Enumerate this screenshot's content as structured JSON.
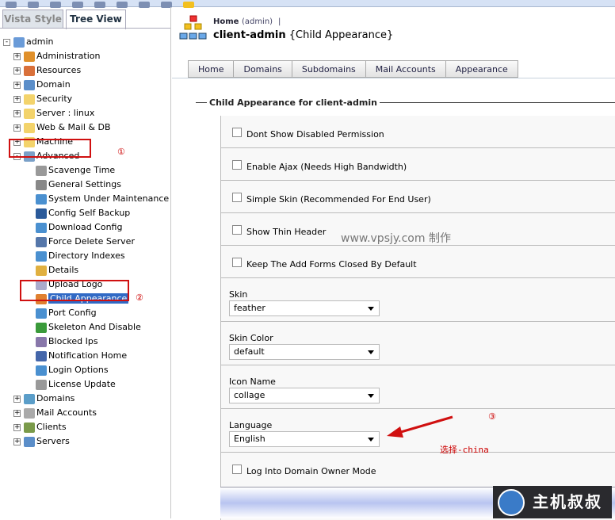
{
  "left_tabs": [
    "Vista Style",
    "Tree View"
  ],
  "tree": [
    {
      "label": "admin",
      "level": 0,
      "pm": "-",
      "color": "#6a9bd8"
    },
    {
      "label": "Administration",
      "level": 1,
      "pm": "+",
      "color": "#e0902a"
    },
    {
      "label": "Resources",
      "level": 1,
      "pm": "+",
      "color": "#d9703a"
    },
    {
      "label": "Domain",
      "level": 1,
      "pm": "+",
      "color": "#5b8ec9"
    },
    {
      "label": "Security",
      "level": 1,
      "pm": "+",
      "color": "#f3d36b"
    },
    {
      "label": "Server  : linux",
      "level": 1,
      "pm": "+",
      "color": "#f3d36b"
    },
    {
      "label": "Web & Mail & DB",
      "level": 1,
      "pm": "+",
      "color": "#f3d36b"
    },
    {
      "label": "Machine",
      "level": 1,
      "pm": "+",
      "color": "#f3d36b"
    },
    {
      "label": "Advanced",
      "level": 1,
      "pm": "-",
      "color": "#7aa0c8"
    },
    {
      "label": "Scavenge Time",
      "level": 2,
      "color": "#999"
    },
    {
      "label": "General Settings",
      "level": 2,
      "color": "#888"
    },
    {
      "label": "System Under Maintenance",
      "level": 2,
      "color": "#4a90d0"
    },
    {
      "label": "Config Self Backup",
      "level": 2,
      "color": "#2a5a9a"
    },
    {
      "label": "Download Config",
      "level": 2,
      "color": "#4a90d0"
    },
    {
      "label": "Force Delete Server",
      "level": 2,
      "color": "#5577aa"
    },
    {
      "label": "Directory Indexes",
      "level": 2,
      "color": "#4a90d0"
    },
    {
      "label": "Details",
      "level": 2,
      "color": "#e0b040"
    },
    {
      "label": "Upload Logo",
      "level": 2,
      "color": "#aac"
    },
    {
      "label": "Child Appearance",
      "level": 2,
      "color": "#e08030",
      "selected": true
    },
    {
      "label": "Port Config",
      "level": 2,
      "color": "#4a90d0"
    },
    {
      "label": "Skeleton And Disable",
      "level": 2,
      "color": "#3a9a3a"
    },
    {
      "label": "Blocked Ips",
      "level": 2,
      "color": "#8877aa"
    },
    {
      "label": "Notification Home",
      "level": 2,
      "color": "#4466aa"
    },
    {
      "label": "Login Options",
      "level": 2,
      "color": "#4a90d0"
    },
    {
      "label": "License Update",
      "level": 2,
      "color": "#999"
    },
    {
      "label": "Domains",
      "level": 1,
      "pm": "+",
      "color": "#5b9ec9"
    },
    {
      "label": "Mail Accounts",
      "level": 1,
      "pm": "+",
      "color": "#aaa"
    },
    {
      "label": "Clients",
      "level": 1,
      "pm": "+",
      "color": "#7a9a4a"
    },
    {
      "label": "Servers",
      "level": 1,
      "pm": "+",
      "color": "#5b8ec9"
    }
  ],
  "annotations": {
    "m1": "①",
    "m2": "②",
    "m3": "③",
    "hint": "选择-china",
    "watermark": "www.vpsjy.com 制作",
    "badge": "主机叔叔"
  },
  "header": {
    "home": "Home",
    "user": "(admin)",
    "sep": "|",
    "title_bold": "client-admin",
    "title_rest": "{Child Appearance}"
  },
  "tabs": [
    "Home",
    "Domains",
    "Subdomains",
    "Mail Accounts",
    "Appearance"
  ],
  "section": "Child Appearance for client-admin",
  "checkboxes": [
    "Dont Show Disabled Permission",
    "Enable Ajax (Needs High Bandwidth)",
    "Simple Skin (Recommended For End User)",
    "Show Thin Header",
    "Keep The Add Forms Closed By Default"
  ],
  "selects": [
    {
      "label": "Skin",
      "value": "feather"
    },
    {
      "label": "Skin Color",
      "value": "default"
    },
    {
      "label": "Icon Name",
      "value": "collage"
    },
    {
      "label": "Language",
      "value": "English"
    }
  ],
  "last_checkbox": "Log Into Domain Owner Mode"
}
